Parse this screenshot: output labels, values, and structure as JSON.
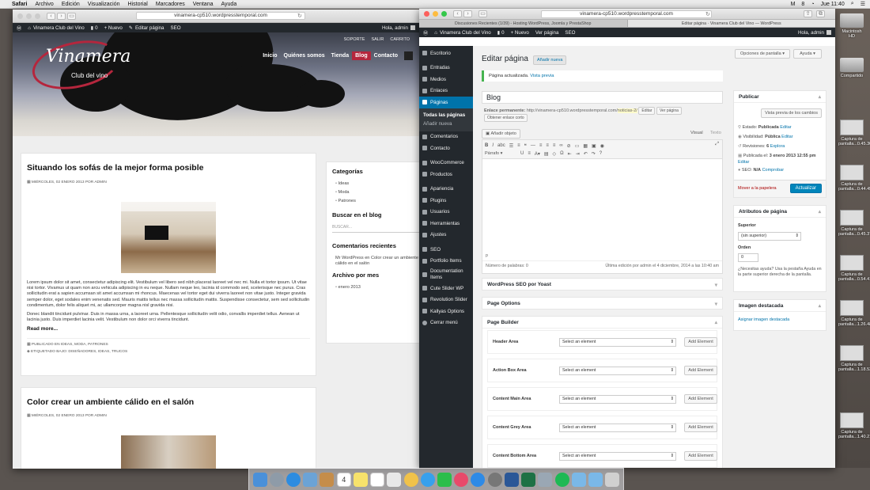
{
  "menubar": {
    "items": [
      "Safari",
      "Archivo",
      "Edición",
      "Visualización",
      "Historial",
      "Marcadores",
      "Ventana",
      "Ayuda"
    ],
    "right": [
      "M",
      "8",
      "Jue 11:40"
    ]
  },
  "desktop": {
    "icons": [
      "Macintosh HD",
      "Compartido",
      "Captura de pantalla...0.45.30",
      "Captura de pantalla...0.44.45",
      "Captura de pantalla...0.45.37",
      "Captura de pantalla...0.54.41",
      "Captura de pantalla...1.26.48",
      "Captura de pantalla...1.18.53",
      "Captura de pantalla...1.40.21"
    ]
  },
  "left_window": {
    "url": "vinamera-cp510.wordpresstemporal.com",
    "adminbar": {
      "site": "Vinamera Club del Vino",
      "comments": "0",
      "new": "Nuevo",
      "edit": "Editar página",
      "seo": "SEO",
      "user": "Hola, admin"
    },
    "topnav": [
      "SOPORTE",
      "SALIR",
      "CARRITO"
    ],
    "mainnav": [
      "Inicio",
      "Quiénes somos",
      "Tienda",
      "Blog",
      "Contacto"
    ],
    "logo": {
      "name": "Vinamera",
      "sub": "Club del vino"
    },
    "post1": {
      "title": "Situando los sofás de la mejor forma posible",
      "meta": "MIÉRCOLES, 02 ENERO 2013 POR ADMIN",
      "para1": "Lorem ipsum dolor sit amet, consectetur adipiscing elit. Vestibulum vel libero sed nibh placerat laoreet vel nec mi. Nulla et tortor ipsum. Ut vitae nisi tortor. Vivamus ut quam non arcu vehicula adipiscing in eu neque. Nullam neque leo, lacinia id commodo sed, scelerisque nec purus. Cras sollicitudin erat a sapien accumsan sit amet accumsan mi rhoncus. Maecenas vel tortor eget dui viverra laoreet non vitae justo. Integer gravida semper dolor, eget sodales enim venenatis sed. Mauris mattis tellus nec massa sollicitudin mattis. Suspendisse consectetur, sem sed sollicitudin condimentum, dolor felis aliquet mi, ac ullamcorper magna nisl gravida nisi.",
      "para2": "Donec blandit tincidunt pulvinar. Duis in massa urna, a laoreet urna. Pellentesque sollicitudin velit odio, convallis imperdiet tellus. Aenean ut lacinia justo. Duis imperdiet lacinia velit. Vestibulum non dolor orci viverra tincidunt.",
      "readmore": "Read more...",
      "published": "PUBLICADO EN IDEAS, MODA, PATRONES",
      "tags": "ETIQUETADO BAJO: DISEÑADORES, IDEAS, TRUCOS"
    },
    "post2": {
      "title": "Color crear un ambiente cálido en el salón",
      "meta": "MIÉRCOLES, 02 ENERO 2013 POR ADMIN"
    },
    "sidebar": {
      "categorias_title": "Categorías",
      "categorias": [
        "Ideas",
        "Moda",
        "Patrones"
      ],
      "search_title": "Buscar en el blog",
      "search_placeholder": "BUSCAR...",
      "comments_title": "Comentarios recientes",
      "comment": "Mr WordPress en Color crear un ambiente cálido en el salón",
      "archive_title": "Archivo por mes",
      "archive": "enero 2013"
    }
  },
  "right_window": {
    "url": "vinamera-cp510.wordpresstemporal.com",
    "tabs": [
      "Discusiones Recientes (1/39) - Hosting WordPress, Joomla y PrestaShop",
      "Editar página · Vinamera Club del Vino — WordPress"
    ],
    "adminbar": {
      "site": "Vinamera Club del Vino",
      "comments": "0",
      "new": "Nuevo",
      "view": "Ver página",
      "seo": "SEO",
      "user": "Hola, admin"
    },
    "menu": [
      "Escritorio",
      "Entradas",
      "Medios",
      "Enlaces",
      "Páginas",
      "Comentarios",
      "Contacto",
      "WooCommerce",
      "Productos",
      "Apariencia",
      "Plugins",
      "Usuarios",
      "Herramientas",
      "Ajustes",
      "SEO",
      "Portfolio Items",
      "Documentation Items",
      "Cute Slider WP",
      "Revolution Slider",
      "Kallyas Options",
      "Cerrar menú"
    ],
    "submenu": [
      "Todas las páginas",
      "Añadir nueva"
    ],
    "screen_options": "Opciones de pantalla",
    "help": "Ayuda",
    "heading": "Editar página",
    "add_new": "Añadir nueva",
    "notice": {
      "text": "Página actualizada.",
      "link": "Vista previa"
    },
    "title_value": "Blog",
    "permalink": {
      "label": "Enlace permanente:",
      "url": "http://vinamera-cp510.wordpresstemporal.com/",
      "slug": "noticias-2/",
      "edit": "Editar",
      "view": "Ver página",
      "shortlink": "Obtener enlace corto"
    },
    "add_media": "Añadir objeto",
    "visual": "Visual",
    "text_tab": "Texto",
    "format": "Párrafo",
    "path": "p",
    "wordcount": "Número de palabras: 0",
    "lastedit": "Última edición por admin el 4 diciembre, 2014 a las 10:40 am",
    "publish": {
      "title": "Publicar",
      "preview": "Vista previa de los cambios",
      "status_label": "Estado:",
      "status": "Publicada",
      "edit": "Editar",
      "visibility_label": "Visibilidad:",
      "visibility": "Pública",
      "revisions_label": "Revisiones:",
      "revisions": "6",
      "explore": "Explora",
      "published_label": "Publicada el:",
      "published": "3 enero 2013 12:55 pm",
      "seo_label": "SEO:",
      "seo": "N/A",
      "check": "Comprobar",
      "trash": "Mover a la papelera",
      "update": "Actualizar"
    },
    "attributes": {
      "title": "Atributos de página",
      "parent_label": "Superior",
      "parent_value": "(sin superior)",
      "order_label": "Orden",
      "order_value": "0",
      "help": "¿Necesitas ayuda? Usa la pestaña Ayuda en la parte superior derecha de la pantalla."
    },
    "featured": {
      "title": "Imagen destacada",
      "link": "Asignar imagen destacada"
    },
    "seo_box": "WordPress SEO por Yoast",
    "page_options": "Page Options",
    "page_builder": {
      "title": "Page Builder",
      "rows": [
        {
          "label": "Header Area",
          "select": "Select an element",
          "button": "Add Element"
        },
        {
          "label": "Action Box Area",
          "select": "Select an element",
          "button": "Add Element"
        },
        {
          "label": "Content Main Area",
          "select": "Select an element",
          "button": "Add Element"
        },
        {
          "label": "Content Grey Area",
          "select": "Select an element",
          "button": "Add Element"
        },
        {
          "label": "Content Bottom Area",
          "select": "Select an element",
          "button": "Add Element"
        }
      ]
    }
  },
  "dock": {
    "apps": [
      "Finder",
      "Launchpad",
      "Safari",
      "Mail",
      "Notes",
      "Calendar",
      "Reminders",
      "Contacts",
      "Photos",
      "Messages",
      "FaceTime",
      "iTunes",
      "App Store",
      "System Preferences",
      "Word",
      "Excel",
      "Preview",
      "Spotify",
      "Downloads",
      "Applications",
      "Trash"
    ]
  }
}
